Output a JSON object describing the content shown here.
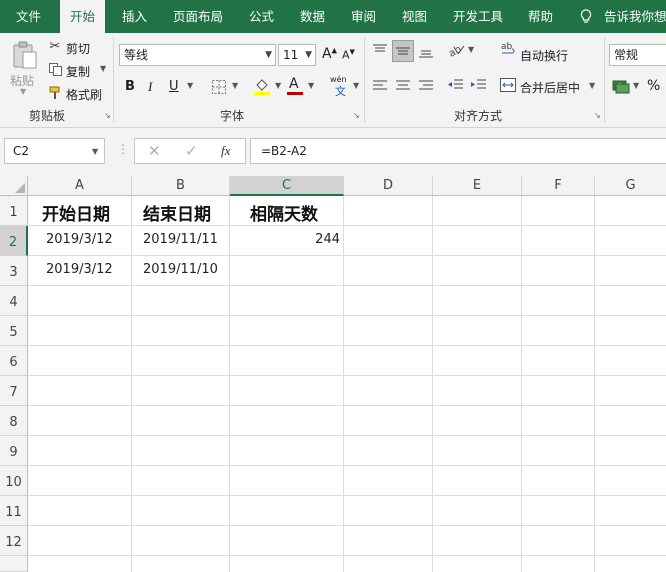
{
  "tabs": [
    {
      "label": "文件"
    },
    {
      "label": "开始"
    },
    {
      "label": "插入"
    },
    {
      "label": "页面布局"
    },
    {
      "label": "公式"
    },
    {
      "label": "数据"
    },
    {
      "label": "审阅"
    },
    {
      "label": "视图"
    },
    {
      "label": "开发工具"
    },
    {
      "label": "帮助"
    }
  ],
  "active_tab": "开始",
  "tell_me": "告诉我你想",
  "clipboard": {
    "paste": "粘贴",
    "cut": "剪切",
    "copy": "复制",
    "format_painter": "格式刷",
    "group_label": "剪贴板"
  },
  "font": {
    "name": "等线",
    "size": "11",
    "bold": "B",
    "italic": "I",
    "underline": "U",
    "grow": "A",
    "shrink": "A",
    "font_color_glyph": "A",
    "phonetic_glyph": "wén",
    "phonetic_sub": "文",
    "group_label": "字体"
  },
  "alignment": {
    "wrap_text": "自动换行",
    "merge_center": "合并后居中",
    "group_label": "对齐方式"
  },
  "number": {
    "format": "常规",
    "percent": "%"
  },
  "formula_bar": {
    "name_box": "C2",
    "fx": "fx",
    "formula": "=B2-A2"
  },
  "columns": [
    "A",
    "B",
    "C",
    "D",
    "E",
    "F",
    "G"
  ],
  "rows": [
    "1",
    "2",
    "3",
    "4",
    "5",
    "6",
    "7",
    "8",
    "9",
    "10",
    "11",
    "12"
  ],
  "cells": {
    "A1": "开始日期",
    "B1": "结束日期",
    "C1": "相隔天数",
    "A2": "2019/3/12",
    "B2": "2019/11/11",
    "C2": "244",
    "A3": "2019/3/12",
    "B3": "2019/11/10"
  },
  "colors": {
    "accent": "#217346",
    "ribbon_bg": "#f3f3f3",
    "font_color_bar": "#c00000",
    "fill_color_bar": "#ffff00"
  }
}
